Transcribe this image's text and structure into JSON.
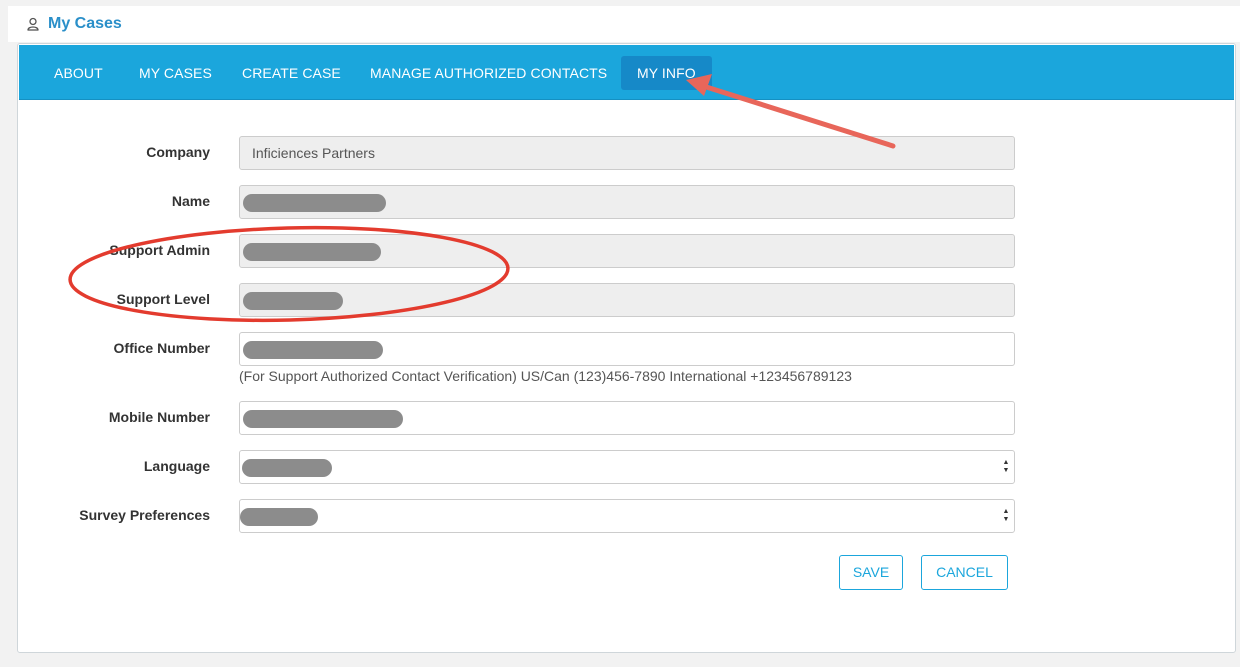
{
  "header": {
    "title": "My Cases",
    "icon": "user-icon"
  },
  "nav": {
    "items": [
      "ABOUT",
      "MY CASES",
      "CREATE CASE",
      "MANAGE AUTHORIZED CONTACTS",
      "MY INFO"
    ],
    "active_item": "MY INFO"
  },
  "form": {
    "company_label": "Company",
    "company_value": "Inficiences Partners",
    "name_label": "Name",
    "support_admin_label": "Support Admin",
    "support_level_label": "Support Level",
    "office_number_label": "Office Number",
    "office_help": "(For Support Authorized Contact Verification) US/Can (123)456-7890 International +123456789123",
    "mobile_number_label": "Mobile Number",
    "language_label": "Language",
    "survey_label": "Survey Preferences",
    "save_label": "SAVE",
    "cancel_label": "CANCEL"
  },
  "colors": {
    "accent": "#1ba6dc",
    "active_tab": "#1689c8",
    "title_blue": "#2a8fc9",
    "annotation_red": "#e33b2e"
  }
}
